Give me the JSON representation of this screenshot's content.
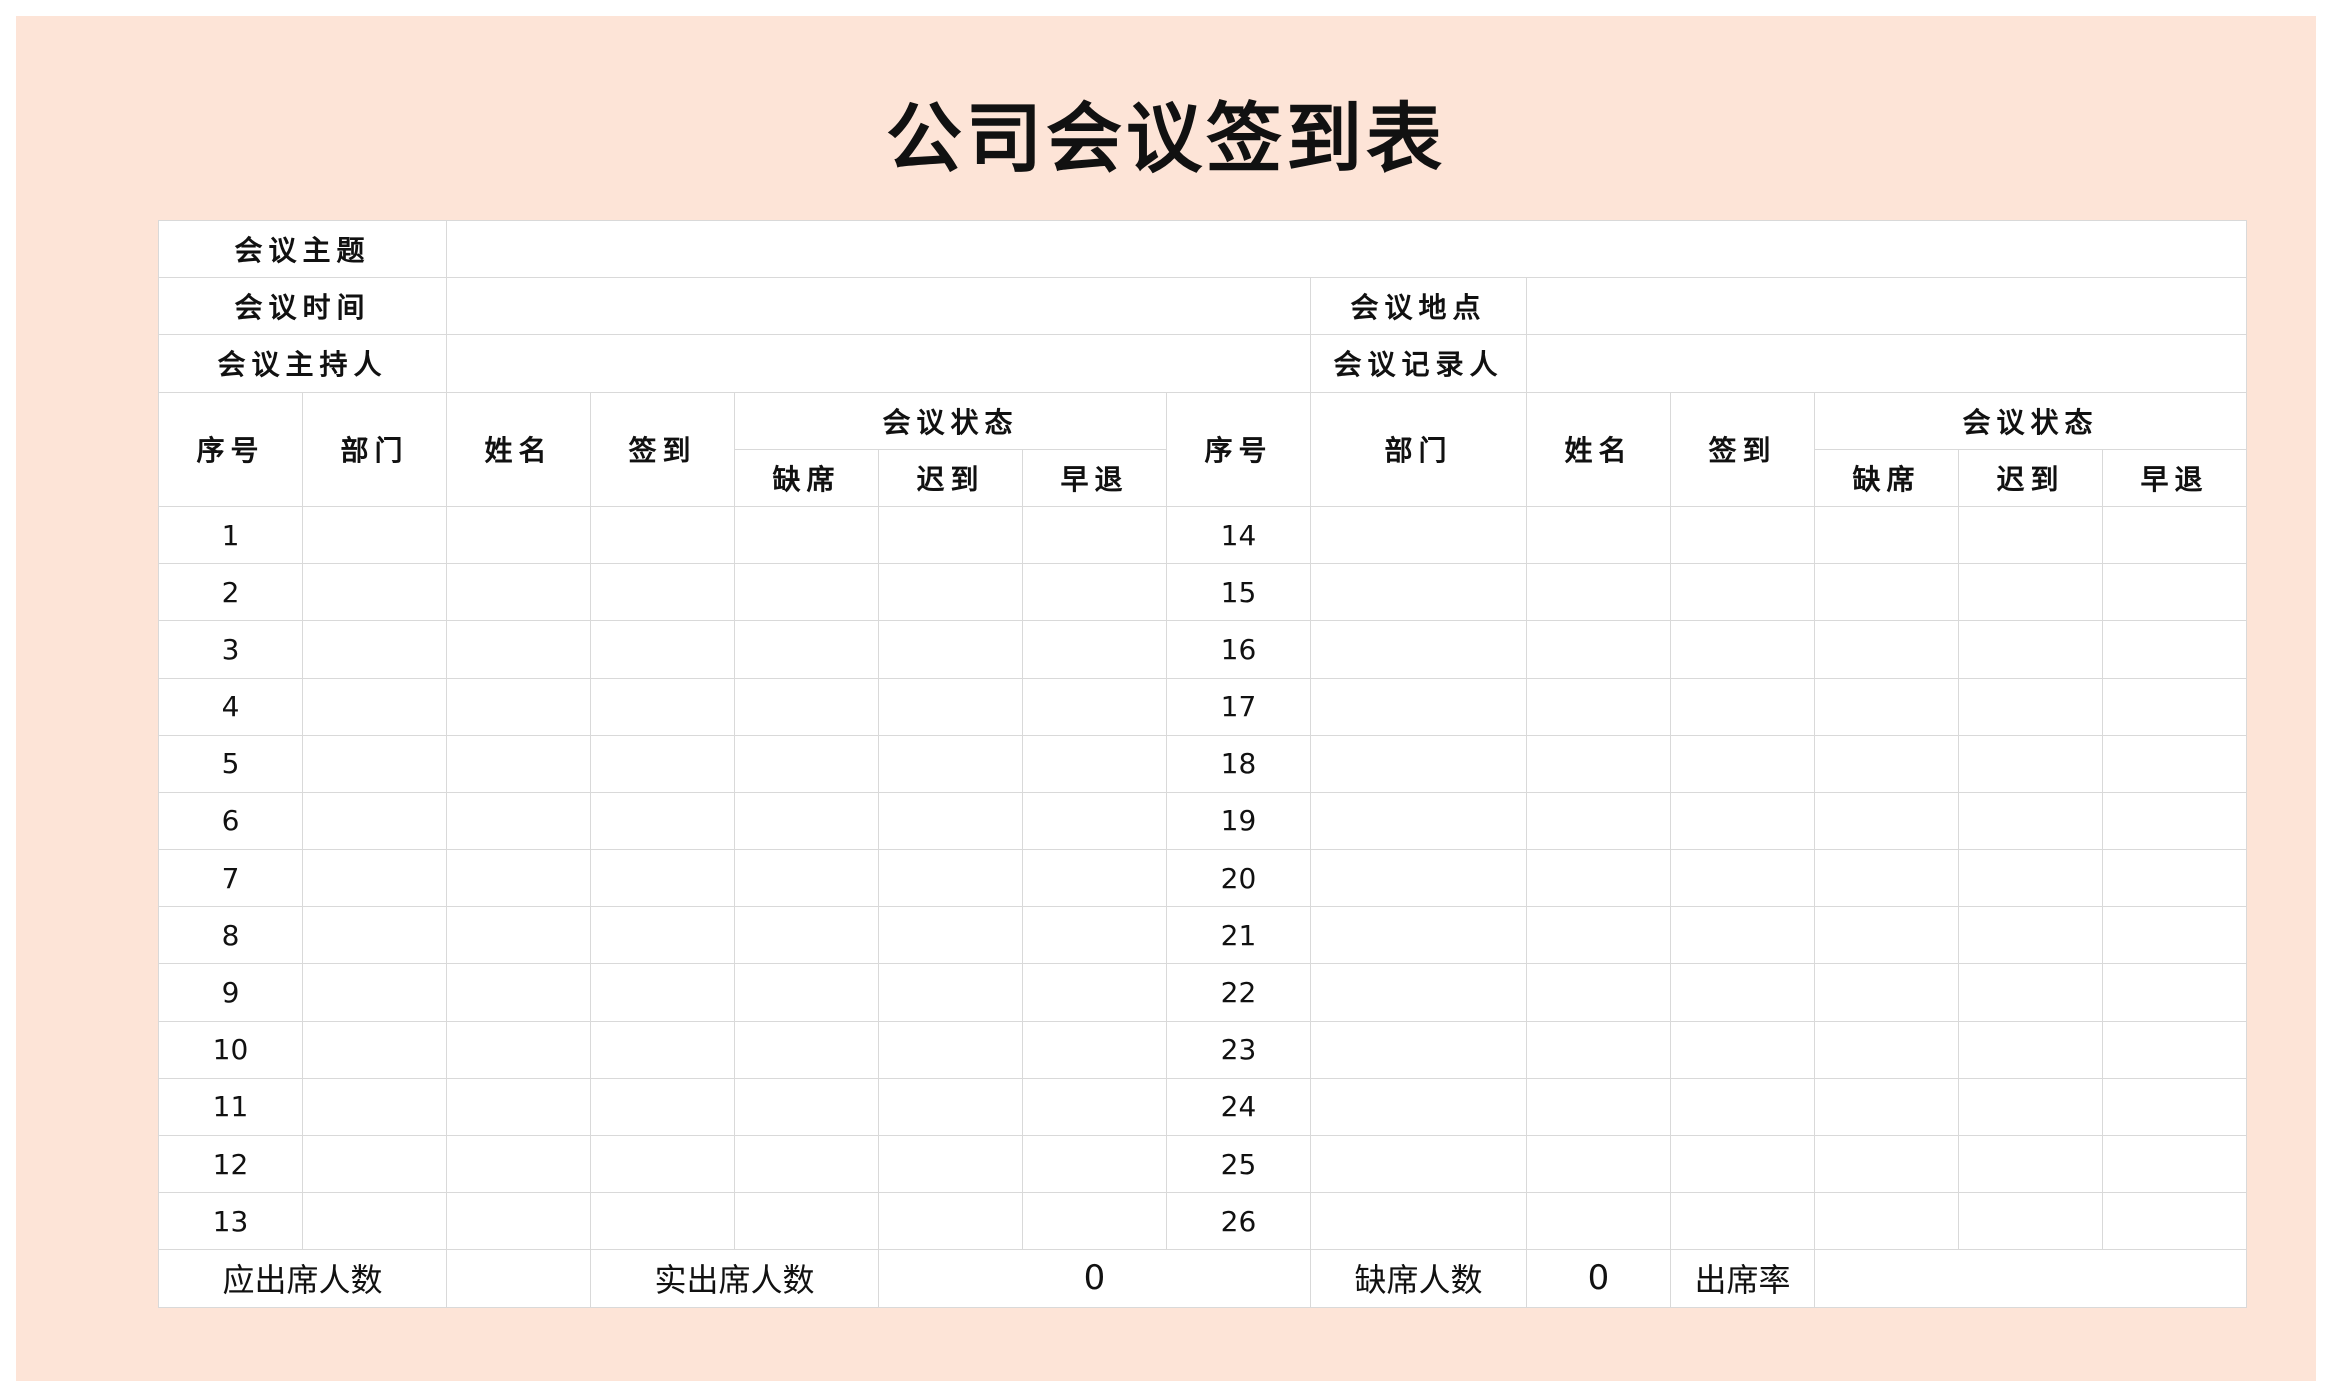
{
  "title": "公司会议签到表",
  "info": {
    "topic_label": "会议主题",
    "topic_value": "",
    "time_label": "会议时间",
    "time_value": "",
    "place_label": "会议地点",
    "place_value": "",
    "host_label": "会议主持人",
    "host_value": "",
    "recorder_label": "会议记录人",
    "recorder_value": ""
  },
  "headers": {
    "seq": "序号",
    "dept": "部门",
    "name": "姓名",
    "signin": "签到",
    "status": "会议状态",
    "absent": "缺席",
    "late": "迟到",
    "early_leave": "早退"
  },
  "rows": [
    {
      "left_seq": "1",
      "right_seq": "14"
    },
    {
      "left_seq": "2",
      "right_seq": "15"
    },
    {
      "left_seq": "3",
      "right_seq": "16"
    },
    {
      "left_seq": "4",
      "right_seq": "17"
    },
    {
      "left_seq": "5",
      "right_seq": "18"
    },
    {
      "left_seq": "6",
      "right_seq": "19"
    },
    {
      "left_seq": "7",
      "right_seq": "20"
    },
    {
      "left_seq": "8",
      "right_seq": "21"
    },
    {
      "left_seq": "9",
      "right_seq": "22"
    },
    {
      "left_seq": "10",
      "right_seq": "23"
    },
    {
      "left_seq": "11",
      "right_seq": "24"
    },
    {
      "left_seq": "12",
      "right_seq": "25"
    },
    {
      "left_seq": "13",
      "right_seq": "26"
    }
  ],
  "summary": {
    "expected_label": "应出席人数",
    "expected_value": "",
    "actual_label": "实出席人数",
    "actual_value": "0",
    "absent_label": "缺席人数",
    "absent_value": "0",
    "rate_label": "出席率",
    "rate_value": ""
  }
}
